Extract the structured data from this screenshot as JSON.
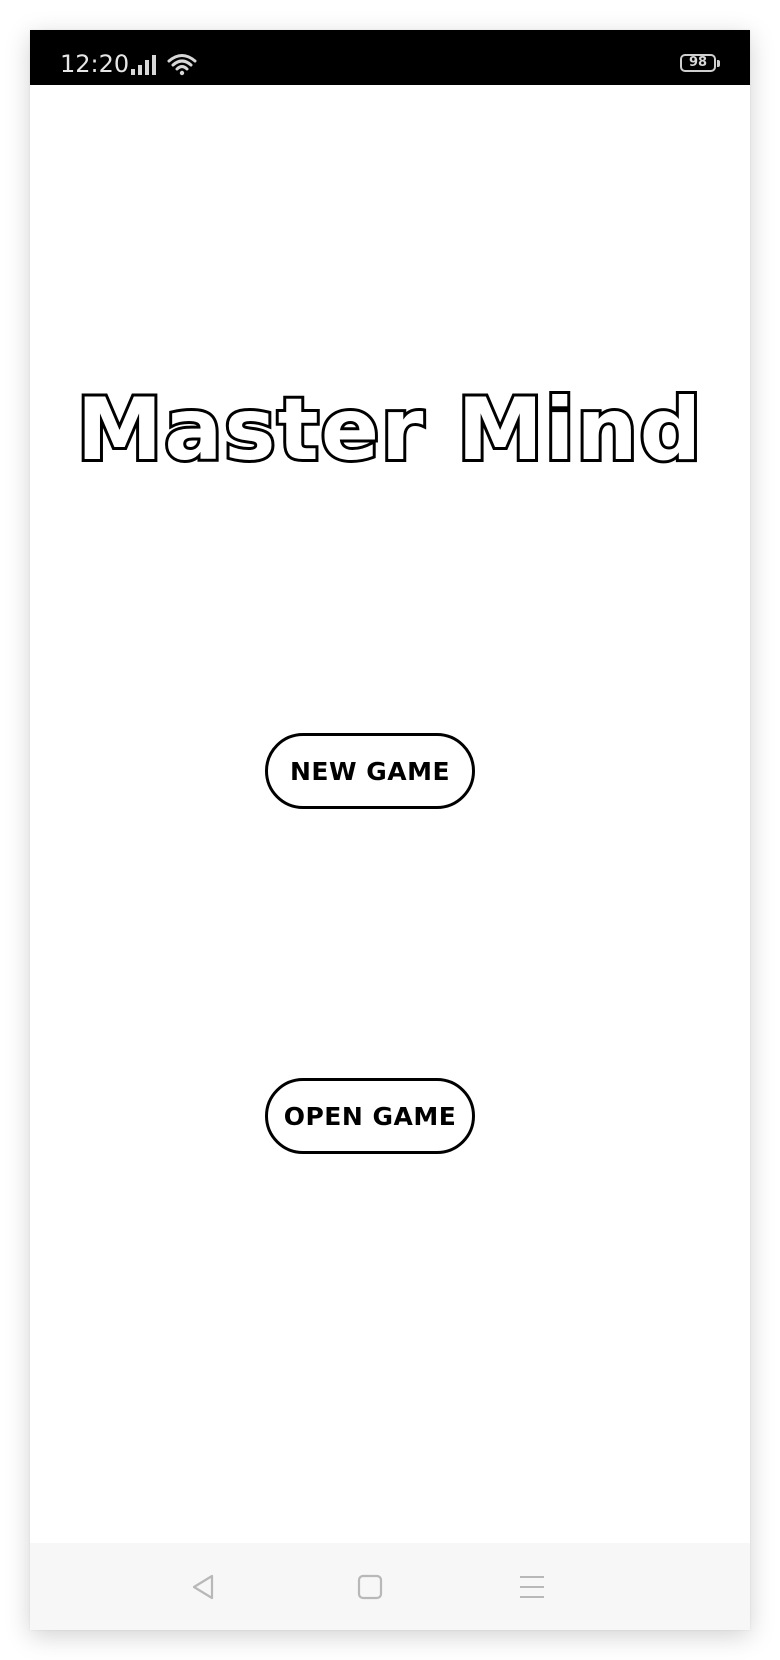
{
  "status_bar": {
    "time": "12:20",
    "battery_level": "98",
    "icons": [
      "signal-icon",
      "wifi-icon",
      "battery-icon"
    ]
  },
  "app": {
    "title": "Master Mind"
  },
  "menu": {
    "new_game_label": "NEW GAME",
    "open_game_label": "OPEN GAME"
  },
  "nav_bar": {
    "buttons": [
      "back-icon",
      "home-icon",
      "recents-icon"
    ]
  },
  "colors": {
    "background": "#ffffff",
    "status_bar": "#000000",
    "button_border": "#000000",
    "nav_bar": "#f7f7f7"
  }
}
